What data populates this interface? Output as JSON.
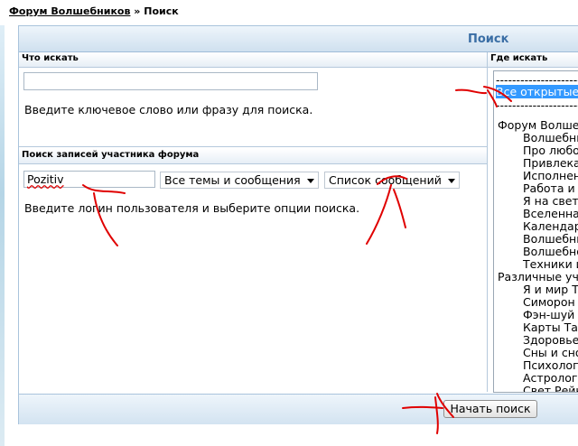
{
  "breadcrumb": {
    "forum_link": "Форум Волшебников",
    "separator": "»",
    "current": "Поиск"
  },
  "panel_title": "Поиск",
  "search_what": {
    "header": "Что искать",
    "keyword_value": "",
    "hint": "Введите ключевое слово или фразу для поиска."
  },
  "search_user": {
    "header": "Поиск записей участника форума",
    "username_value": "Pozitiv",
    "scope_select": "Все темы и сообщения",
    "display_select": "Список сообщений",
    "hint": "Введите логин пользователя и выберите опции поиска."
  },
  "where": {
    "header": "Где искать",
    "items": [
      {
        "label": "-------------------------"
      },
      {
        "label": "Все открытые",
        "selected": true
      },
      {
        "label": "-------------------------"
      },
      {
        "label": "Форум Волшебн"
      },
      {
        "label": "Волшебны"
      },
      {
        "label": "Про любов"
      },
      {
        "label": "Привлекат"
      },
      {
        "label": "Исполнени"
      },
      {
        "label": "Работа и д"
      },
      {
        "label": "Я на свете"
      },
      {
        "label": "Вселенная"
      },
      {
        "label": "Календарь"
      },
      {
        "label": "Волшебны"
      },
      {
        "label": "Волшебнос"
      },
      {
        "label": "Техники и"
      },
      {
        "label": "Различные уче"
      },
      {
        "label": "Я и мир Тал"
      },
      {
        "label": "Симорон"
      },
      {
        "label": "Фэн-шуй"
      },
      {
        "label": "Карты Таро"
      },
      {
        "label": "Здоровье"
      },
      {
        "label": "Сны и сно"
      },
      {
        "label": "Психологи"
      },
      {
        "label": "Астрология"
      },
      {
        "label": "Свет Рейки"
      }
    ]
  },
  "submit_label": "Начать поиск",
  "colors": {
    "title": "#3a6ea5",
    "selection": "#3399ff",
    "annotation": "#e00000"
  }
}
